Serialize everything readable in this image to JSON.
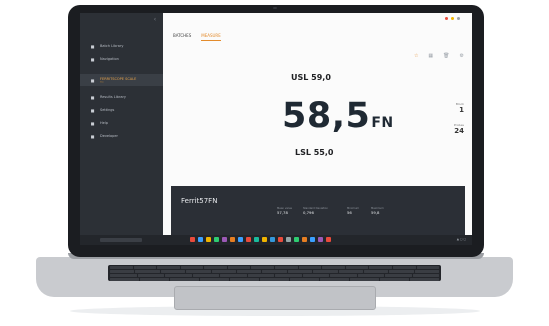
{
  "sidebar": {
    "items": [
      {
        "label": "Batch Library",
        "icon": "grid-icon",
        "active": false
      },
      {
        "label": "Navigation",
        "icon": "home-icon",
        "active": false
      },
      {
        "label": "FERRITSCOPE SCALE",
        "sub": "FN",
        "icon": "gauge-icon",
        "active": true
      },
      {
        "label": "Results Library",
        "icon": "list-icon",
        "active": false
      },
      {
        "label": "Settings",
        "icon": "gear-icon",
        "active": false
      },
      {
        "label": "Help",
        "icon": "help-icon",
        "active": false
      },
      {
        "label": "Developer",
        "icon": "code-icon",
        "active": false
      }
    ]
  },
  "tabs": [
    {
      "label": "BATCHES",
      "active": false
    },
    {
      "label": "MEASURE",
      "active": true
    }
  ],
  "topbar": {
    "indicator_colors": [
      "#e94b3c",
      "#f0b400",
      "#9aa0a8"
    ]
  },
  "toolbar_icons": [
    "star-icon",
    "grid-icon",
    "trash-icon",
    "settings-icon"
  ],
  "measurement": {
    "usl": "USL 59,0",
    "value": "58,5",
    "unit": "FN",
    "lsl": "LSL 55,0"
  },
  "side_stats": {
    "block_label": "Block",
    "block_value": "1",
    "probes_label": "Probes",
    "probes_value": "24"
  },
  "panel": {
    "name": "Ferrit57FN",
    "metrics": [
      {
        "label": "Mean value",
        "value": "57,78"
      },
      {
        "label": "Standard Deviation",
        "value": "0,796"
      },
      {
        "label": "Minimum",
        "value": "56"
      },
      {
        "label": "Maximum",
        "value": "59,8"
      }
    ]
  },
  "taskbar": {
    "app_colors": [
      "#e94b3c",
      "#3aa0ff",
      "#f0b400",
      "#2ecc71",
      "#9b59b6",
      "#e67e22",
      "#3aa0ff",
      "#e94b3c",
      "#1abc9c",
      "#f0b400",
      "#3498db",
      "#e94b3c",
      "#95a5a6",
      "#2ecc71",
      "#e67e22",
      "#3aa0ff",
      "#9b59b6",
      "#e94b3c"
    ]
  },
  "colors": {
    "accent": "#e38b2c",
    "sidebar_bg": "#2c3036",
    "panel_bg": "#2b2f36"
  }
}
